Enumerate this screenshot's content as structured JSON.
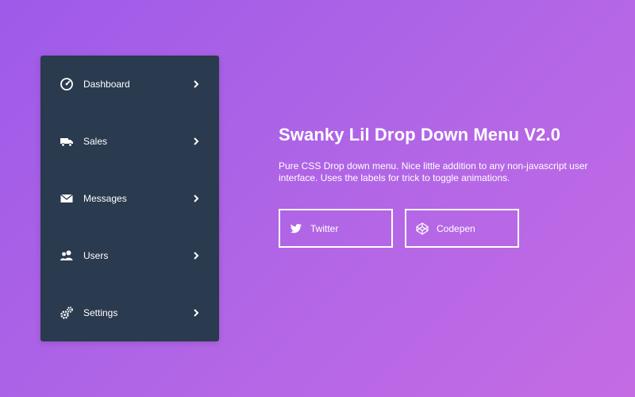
{
  "menu": {
    "items": [
      {
        "label": "Dashboard",
        "icon": "dashboard-gauge-icon"
      },
      {
        "label": "Sales",
        "icon": "truck-icon"
      },
      {
        "label": "Messages",
        "icon": "envelope-icon"
      },
      {
        "label": "Users",
        "icon": "users-icon"
      },
      {
        "label": "Settings",
        "icon": "cogs-icon"
      }
    ]
  },
  "content": {
    "title": "Swanky Lil Drop Down Menu V2.0",
    "description": "Pure CSS Drop down menu. Nice little addition to any non-javascript user interface. Uses the labels for trick to toggle animations.",
    "buttons": [
      {
        "label": "Twitter",
        "icon": "twitter-icon"
      },
      {
        "label": "Codepen",
        "icon": "codepen-icon"
      }
    ]
  },
  "colors": {
    "menu_bg": "#2a3a4f",
    "gradient_start": "#9e5ae8",
    "gradient_end": "#c46be4",
    "text": "#ffffff"
  }
}
